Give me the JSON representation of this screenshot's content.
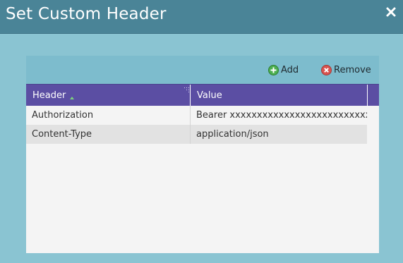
{
  "dialog": {
    "title": "Set Custom Header",
    "close_icon": "close-icon"
  },
  "toolbar": {
    "add_label": "Add",
    "add_icon": "plus-circle-icon",
    "remove_label": "Remove",
    "remove_icon": "x-circle-icon"
  },
  "grid": {
    "columns": [
      {
        "label": "Header",
        "sort_icon": "sort-icon"
      },
      {
        "label": "Value"
      }
    ],
    "rows": [
      {
        "name": "Authorization",
        "value": "Bearer xxxxxxxxxxxxxxxxxxxxxxxxxxx..."
      },
      {
        "name": "Content-Type",
        "value": "application/json"
      }
    ]
  },
  "colors": {
    "titlebar": "#4a8497",
    "background": "#8ac4d2",
    "toolbar": "#7dbccd",
    "grid_header": "#5b4ea3",
    "add_green": "#4caf50",
    "remove_red": "#d9534f"
  }
}
